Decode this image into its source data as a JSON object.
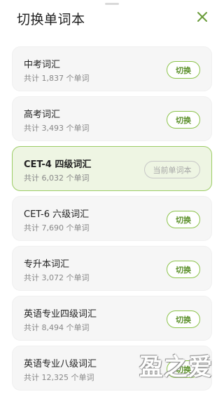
{
  "header": {
    "title": "切换单词本"
  },
  "books": [
    {
      "name": "中考词汇",
      "count": "共计 1,837 个单词",
      "action": "切换",
      "current": false
    },
    {
      "name": "高考词汇",
      "count": "共计 3,493 个单词",
      "action": "切换",
      "current": false
    },
    {
      "name": "CET-4 四级词汇",
      "count": "共计 6,032 个单词",
      "action": "当前单词本",
      "current": true
    },
    {
      "name": "CET-6 六级词汇",
      "count": "共计 7,690 个单词",
      "action": "切换",
      "current": false
    },
    {
      "name": "专升本词汇",
      "count": "共计 3,072 个单词",
      "action": "切换",
      "current": false
    },
    {
      "name": "英语专业四级词汇",
      "count": "共计 8,494 个单词",
      "action": "切换",
      "current": false
    },
    {
      "name": "英语专业八级词汇",
      "count": "共计 12,325 个单词",
      "action": "切换",
      "current": false
    }
  ],
  "watermark": "盈之爱",
  "colors": {
    "accent": "#8bc34a",
    "accent_text": "#5a8f29",
    "current_bg": "#eef5e3",
    "card_bg": "#f6f6f6"
  },
  "icons": {
    "close": "close-icon"
  }
}
